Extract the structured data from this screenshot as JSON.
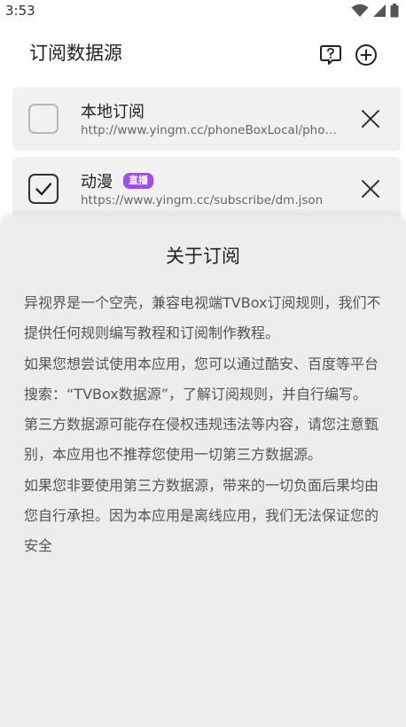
{
  "status": {
    "time": "3:53",
    "icons": [
      "wifi-icon",
      "signal-icon",
      "battery-icon"
    ]
  },
  "header": {
    "title": "订阅数据源",
    "help_icon": "question-bubble-icon",
    "add_icon": "plus-circle-icon"
  },
  "subscriptions": [
    {
      "name": "本地订阅",
      "url": "http://www.yingm.cc/phoneBoxLocal/phoneBoxLocal.json",
      "checked": false,
      "badge": ""
    },
    {
      "name": "动漫",
      "url": "https://www.yingm.cc/subscribe/dm.json",
      "checked": true,
      "badge": "直播"
    }
  ],
  "sheet": {
    "title": "关于订阅",
    "paragraphs": [
      "异视界是一个空壳，兼容电视端TVBox订阅规则，我们不提供任何规则编写教程和订阅制作教程。",
      "如果您想尝试使用本应用，您可以通过酷安、百度等平台搜索：“TVBox数据源”，了解订阅规则，并自行编写。",
      "第三方数据源可能存在侵权违规违法等内容，请您注意甄别，本应用也不推荐您使用一切第三方数据源。",
      "如果您非要使用第三方数据源，带来的一切负面后果均由您自行承担。因为本应用是离线应用，我们无法保证您的安全"
    ]
  },
  "colors": {
    "badge": "#9c4df2",
    "card_bg": "#f1f1f1",
    "sheet_bg": "#ededed"
  }
}
